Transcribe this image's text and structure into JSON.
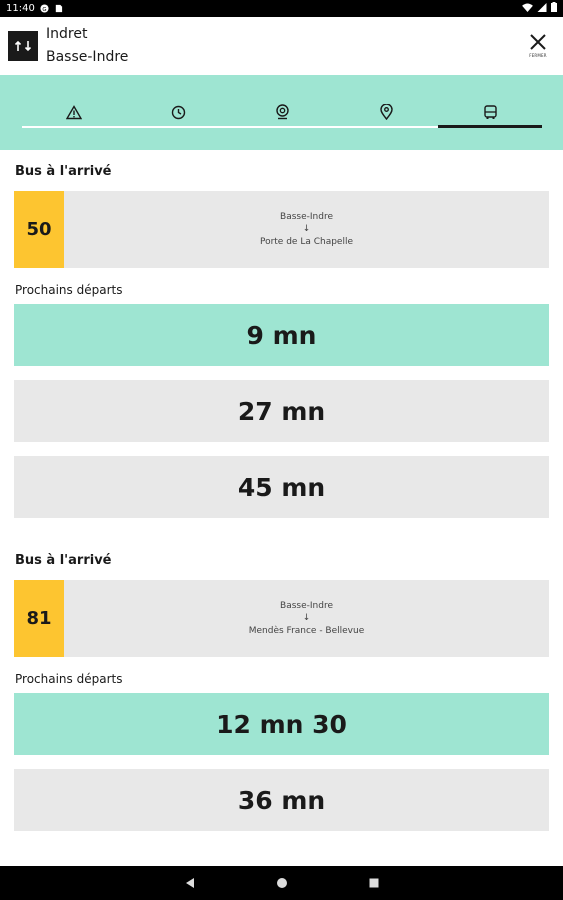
{
  "status_bar": {
    "time": "11:40"
  },
  "header": {
    "from": "Indret",
    "to": "Basse-Indre",
    "close_label": "FERMER"
  },
  "tabs": [
    {
      "icon": "warning-icon"
    },
    {
      "icon": "clock-icon"
    },
    {
      "icon": "stop-pin-icon"
    },
    {
      "icon": "location-pin-icon"
    },
    {
      "icon": "bus-icon",
      "active": true
    }
  ],
  "sections": [
    {
      "title": "Bus à l'arrivé",
      "line": "50",
      "origin": "Basse-Indre",
      "arrow": "↓",
      "destination": "Porte de La Chapelle",
      "departures_title": "Prochains départs",
      "departures": [
        "9 mn",
        "27 mn",
        "45 mn"
      ]
    },
    {
      "title": "Bus à l'arrivé",
      "line": "81",
      "origin": "Basse-Indre",
      "arrow": "↓",
      "destination": "Mendès France - Bellevue",
      "departures_title": "Prochains départs",
      "departures": [
        "12 mn 30",
        "36 mn"
      ]
    }
  ],
  "colors": {
    "accent": "#9ee5d2",
    "line_badge": "#fdc530",
    "card": "#e8e8e8"
  }
}
